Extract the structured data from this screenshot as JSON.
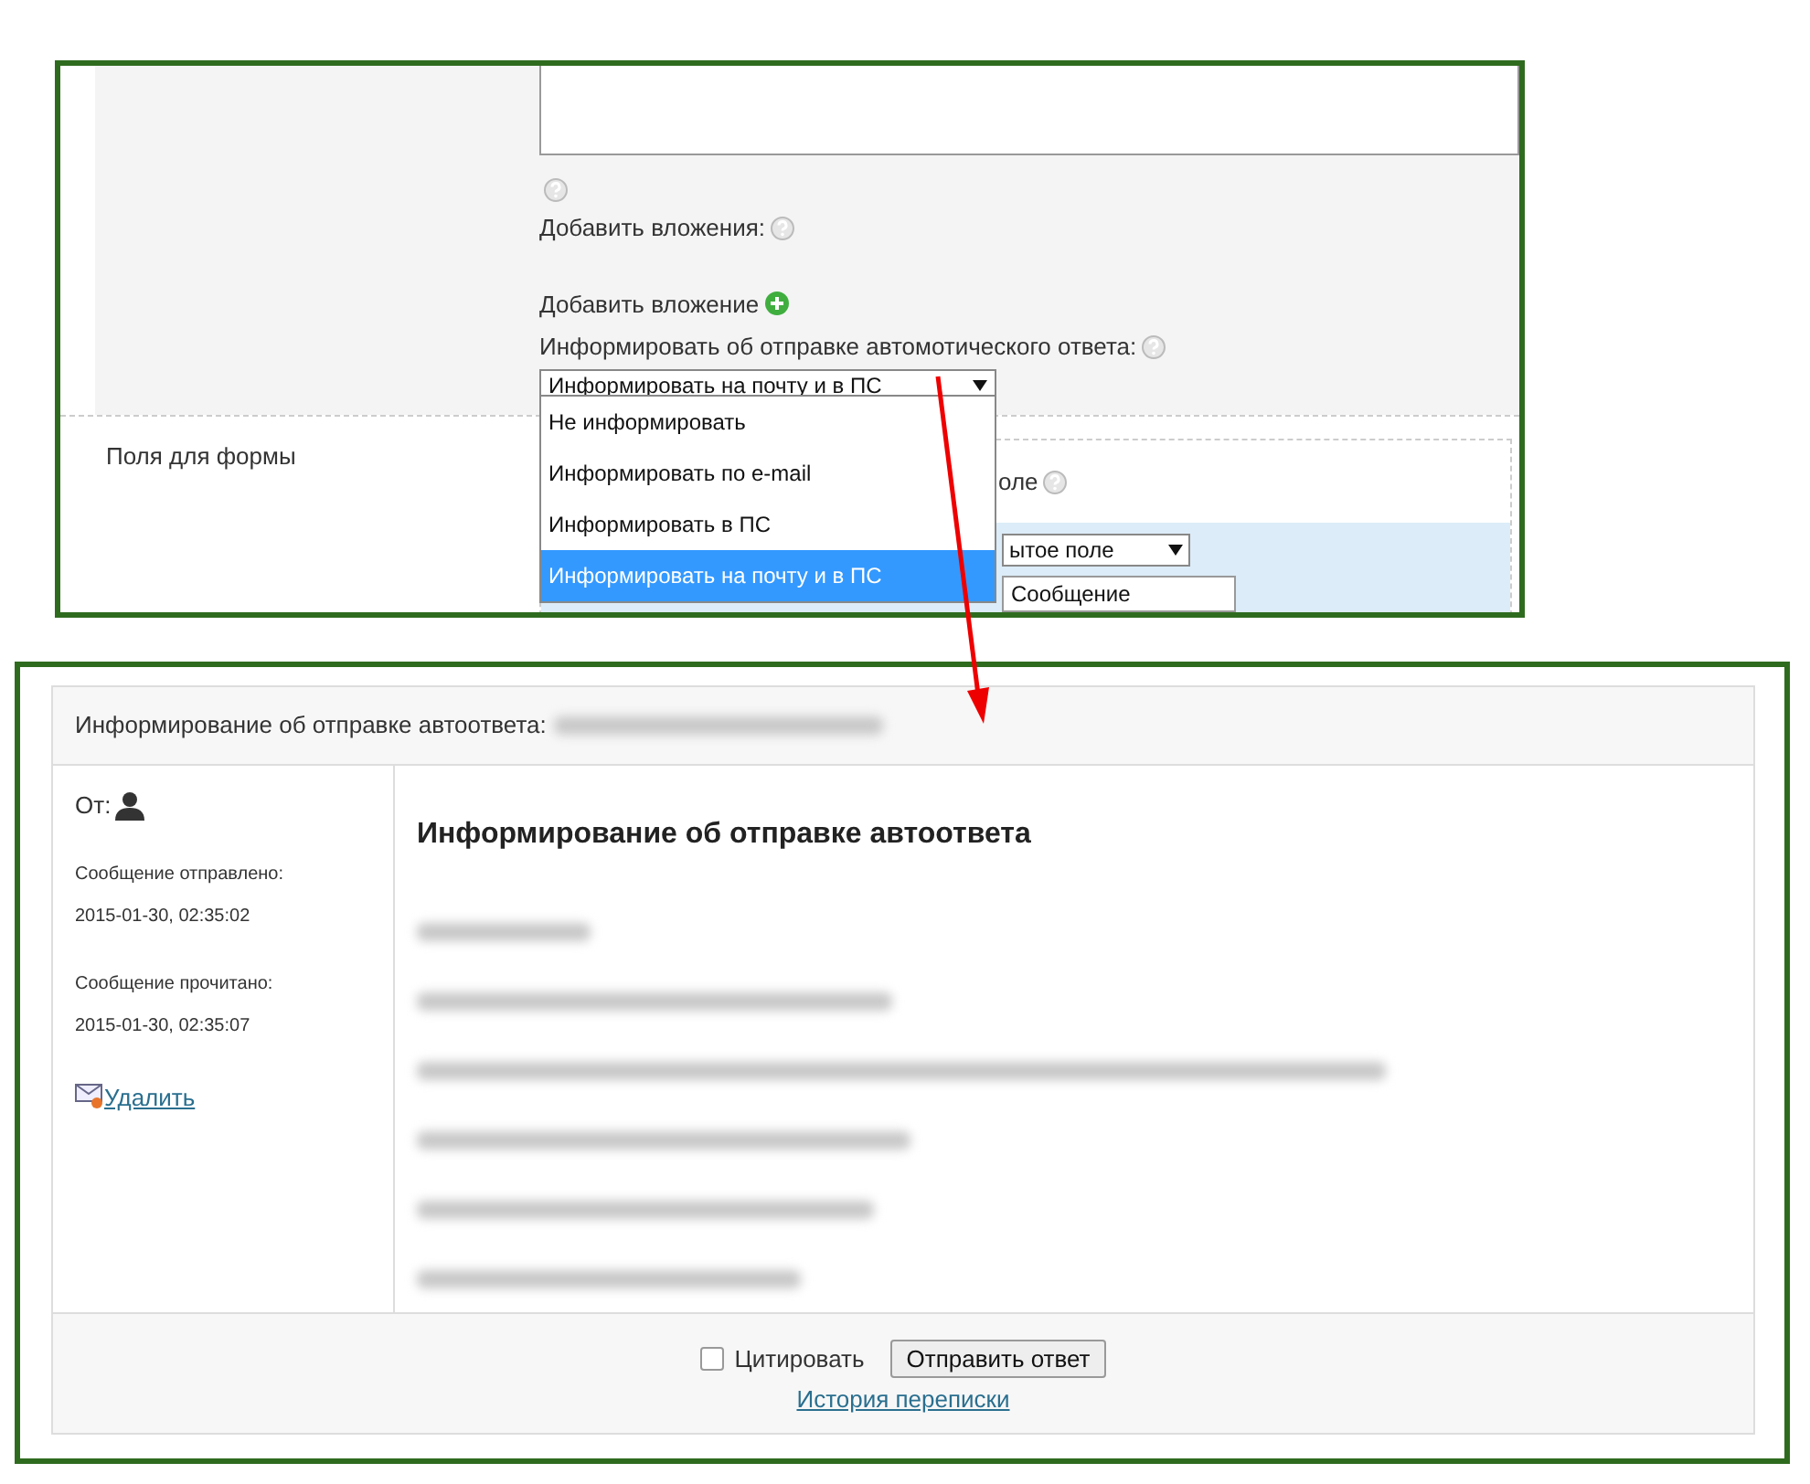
{
  "form_editor": {
    "attachments_label": "Добавить вложения:",
    "add_attachment_link": "Добавить вложение",
    "notify_label": "Информировать об отправке автомотического ответа:",
    "notify_select": {
      "value": "Информировать на почту и в ПС",
      "expanded": true,
      "options": [
        {
          "label": "Не информировать",
          "selected": false
        },
        {
          "label": "Информировать по e-mail",
          "selected": false
        },
        {
          "label": "Информировать в ПС",
          "selected": false
        },
        {
          "label": "Информировать на почту и в ПС",
          "selected": true
        }
      ]
    },
    "form_fields_label": "Поля для формы",
    "field_label_partial": "оле",
    "field_type_partial": "ытое поле",
    "field_name_value": "Сообщение"
  },
  "message": {
    "header": "Информирование об отправке автоответа:",
    "from_label": "От:",
    "sent_label": "Сообщение отправлено:",
    "sent_time": "2015-01-30, 02:35:02",
    "read_label": "Сообщение прочитано:",
    "read_time": "2015-01-30, 02:35:07",
    "delete_link": "Удалить",
    "title": "Информирование об отправке автоответа",
    "quote": {
      "label": "Цитировать",
      "checked": false
    },
    "reply_button": "Отправить ответ",
    "history_link": "История переписки"
  }
}
